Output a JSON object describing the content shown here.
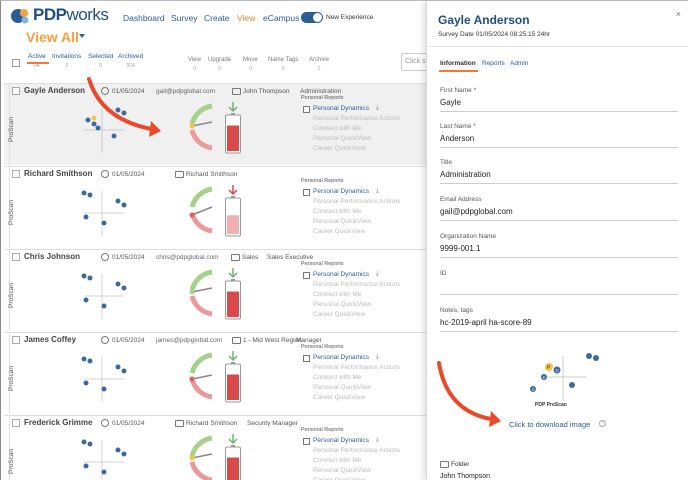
{
  "nav": {
    "logo": "PDP",
    "logo_suffix": "works",
    "items": [
      "Dashboard",
      "Survey",
      "Create",
      "View",
      "eCampus"
    ],
    "active_item": "View",
    "toggle_label": "New Experience"
  },
  "header": {
    "title": "View All",
    "tabs": [
      {
        "label": "Active",
        "count": "94"
      },
      {
        "label": "Invitations",
        "count": "2"
      },
      {
        "label": "Selected",
        "count": "0"
      },
      {
        "label": "Archived",
        "count": "974"
      }
    ],
    "actions": [
      {
        "label": "View",
        "count": "0"
      },
      {
        "label": "Upgrade",
        "count": "0"
      },
      {
        "label": "Move",
        "count": "0"
      },
      {
        "label": "Name Tags",
        "count": "0"
      },
      {
        "label": "Archive",
        "count": "0"
      }
    ],
    "search_placeholder": "Click s"
  },
  "rows": [
    {
      "name": "Gayle Anderson",
      "date": "01/05/2024",
      "email": "gail@pdpglobal.com",
      "folder": "John Thompson",
      "title": "Administration",
      "side": "ProScan",
      "battery_fill": 0.75
    },
    {
      "name": "Richard Smithson",
      "date": "01/05/2024",
      "email": "",
      "folder": "Richard Smithson",
      "title": "",
      "side": "ProScan",
      "battery_fill": 0.55
    },
    {
      "name": "Chris Johnson",
      "date": "01/05/2024",
      "email": "chris@pdpglobal.com",
      "folder": "Sales",
      "title": "Sales Executive",
      "side": "ProScan",
      "battery_fill": 0.75
    },
    {
      "name": "James Coffey",
      "date": "01/05/2024",
      "email": "james@pdpglobal.com",
      "folder": "1 - Mid West Region",
      "title": "Manager",
      "side": "ProScan",
      "battery_fill": 0.75
    },
    {
      "name": "Frederick Grimme",
      "date": "01/05/2024",
      "email": "",
      "folder": "Richard Smithson",
      "title": "Security Manager",
      "side": "ProScan",
      "battery_fill": 0.75
    }
  ],
  "reports": {
    "heading": "Personal Reports",
    "items": [
      "Personal Dynamics",
      "Personal Performance Actions",
      "Connect with Me",
      "Personal QuickView",
      "Career QuickView"
    ]
  },
  "panel": {
    "name": "Gayle Anderson",
    "survey_date": "Survey Date 01/05/2024 08:25:15 24hr",
    "close": "×",
    "tabs": [
      "Information",
      "Reports",
      "Admin"
    ],
    "fields": [
      {
        "label": "First Name *",
        "value": "Gayle"
      },
      {
        "label": "Last Name *",
        "value": "Anderson"
      },
      {
        "label": "Title",
        "value": "Administration"
      },
      {
        "label": "Email Address",
        "value": "gail@pdpglobal.com"
      },
      {
        "label": "Organization Name",
        "value": "9999-001.1"
      },
      {
        "label": "ID",
        "value": ""
      },
      {
        "label": "Notes, tags",
        "value": "hc-2019-april  ha-score-89"
      }
    ],
    "chart_brand": "PDP ProScan",
    "download_label": "Click to download image",
    "help": "?",
    "folder_label": "Folder",
    "folder_value": "John Thompson"
  },
  "colors": {
    "brand_blue": "#1e4f87",
    "link_blue": "#2a5d96",
    "accent_orange": "#f47b20",
    "arrow_red": "#e84a2a",
    "gauge_green": "#a8d08d",
    "gauge_red": "#e99a9a",
    "battery_red": "#d94a4a"
  },
  "icons": [
    "checkbox-icon",
    "calendar-check-icon",
    "folder-icon",
    "download-icon",
    "close-icon",
    "help-icon",
    "caret-down-icon"
  ]
}
